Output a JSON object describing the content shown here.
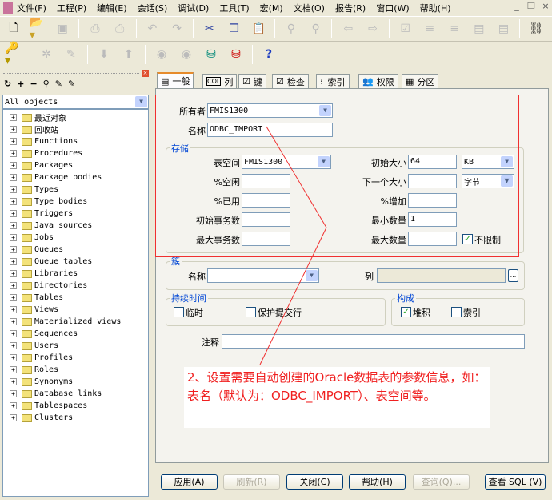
{
  "menu": [
    "文件(F)",
    "工程(P)",
    "编辑(E)",
    "会话(S)",
    "调试(D)",
    "工具(T)",
    "宏(M)",
    "文档(O)",
    "报告(R)",
    "窗口(W)",
    "帮助(H)"
  ],
  "window_controls": {
    "minimize": "_",
    "restore": "❐",
    "close": "×"
  },
  "left_panel": {
    "filter": "All objects",
    "tree": [
      "最近对象",
      "回收站",
      "Functions",
      "Procedures",
      "Packages",
      "Package bodies",
      "Types",
      "Type bodies",
      "Triggers",
      "Java sources",
      "Jobs",
      "Queues",
      "Queue tables",
      "Libraries",
      "Directories",
      "Tables",
      "Views",
      "Materialized views",
      "Sequences",
      "Users",
      "Profiles",
      "Roles",
      "Synonyms",
      "Database links",
      "Tablespaces",
      "Clusters"
    ]
  },
  "tabs": [
    "一般",
    "列",
    "键",
    "检查",
    "索引",
    "权限",
    "分区"
  ],
  "general": {
    "owner_label": "所有者",
    "owner": "FMIS1300",
    "name_label": "名称",
    "name": "ODBC_IMPORT",
    "storage": {
      "legend": "存储",
      "tablespace_label": "表空间",
      "tablespace": "FMIS1300",
      "pctfree_label": "%空闲",
      "pctfree": "",
      "pctused_label": "%已用",
      "pctused": "",
      "initrans_label": "初始事务数",
      "initrans": "",
      "maxtrans_label": "最大事务数",
      "maxtrans": "",
      "initial_label": "初始大小",
      "initial": "64",
      "initial_unit": "KB",
      "next_label": "下一个大小",
      "next": "",
      "next_unit": "字节",
      "pctincrease_label": "%增加",
      "pctincrease": "",
      "minextents_label": "最小数量",
      "minextents": "1",
      "maxextents_label": "最大数量",
      "maxextents": "",
      "unlimited_label": "不限制",
      "unlimited": true
    },
    "cluster": {
      "legend": "簇",
      "name_label": "名称",
      "name": "",
      "columns_label": "列",
      "columns": "",
      "browse": "..."
    },
    "duration": {
      "legend": "持续时间",
      "temporary_label": "临时",
      "temporary": false,
      "preserve_label": "保护提交行",
      "preserve": false
    },
    "organization": {
      "legend": "构成",
      "heap_label": "堆积",
      "heap": true,
      "index_label": "索引",
      "index": false
    },
    "comment_label": "注释",
    "comment": ""
  },
  "annotation": "2、设置需要自动创建的Oracle数据表的参数信息，如：表名（默认为：ODBC_IMPORT）、表空间等。",
  "buttons": {
    "apply": "应用(A)",
    "refresh": "刷新(R)",
    "close": "关闭(C)",
    "help": "帮助(H)",
    "query": "查询(Q)...",
    "view_sql": "查看 SQL (V)"
  },
  "colors": {
    "annotation": "#f02020",
    "accent": "#0046d5"
  }
}
